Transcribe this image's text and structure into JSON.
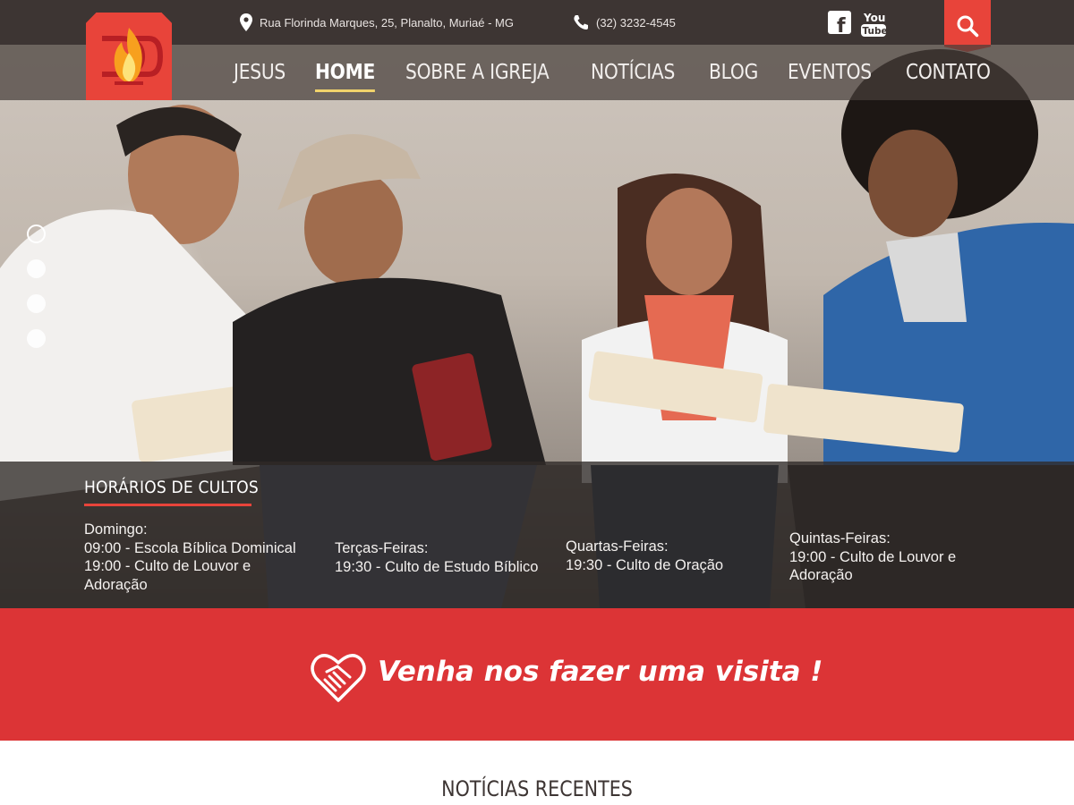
{
  "topbar": {
    "address": "Rua Florinda Marques, 25, Planalto, Muriaé - MG",
    "phone": "(32) 3232-4545",
    "social": [
      {
        "name": "facebook",
        "label": "f"
      },
      {
        "name": "youtube",
        "label_top": "You",
        "label_bottom": "Tube"
      }
    ],
    "search_icon": "search-icon"
  },
  "logo": {
    "name": "church-flame-logo"
  },
  "nav": {
    "items": [
      {
        "label": "JESUS",
        "active": false
      },
      {
        "label": "HOME",
        "active": true
      },
      {
        "label": "SOBRE A IGREJA",
        "active": false
      },
      {
        "label": "NOTÍCIAS",
        "active": false
      },
      {
        "label": "BLOG",
        "active": false
      },
      {
        "label": "EVENTOS",
        "active": false
      },
      {
        "label": "CONTATO",
        "active": false
      }
    ]
  },
  "slider": {
    "slides": 4,
    "active_index": 0
  },
  "schedule": {
    "title": "HORÁRIOS DE CULTOS",
    "columns": [
      {
        "day": "Domingo:",
        "lines": [
          "09:00 - Escola Bíblica Dominical",
          "19:00 - Culto de Louvor e",
          "Adoração"
        ]
      },
      {
        "day": "Terças-Feiras:",
        "lines": [
          "19:30 - Culto de Estudo Bíblico"
        ]
      },
      {
        "day": "Quartas-Feiras:",
        "lines": [
          "19:30 - Culto de Oração"
        ]
      },
      {
        "day": "Quintas-Feiras:",
        "lines": [
          "19:00 - Culto de Louvor e",
          "Adoração"
        ]
      }
    ]
  },
  "visit": {
    "icon": "handshake-heart-icon",
    "text": "Venha nos fazer uma visita !"
  },
  "news": {
    "title": "NOTÍCIAS RECENTES"
  },
  "colors": {
    "topbar": "#3d3533",
    "accent_red": "#e8443a",
    "band_red": "#dc3436",
    "nav_underline": "#f1d36b"
  }
}
